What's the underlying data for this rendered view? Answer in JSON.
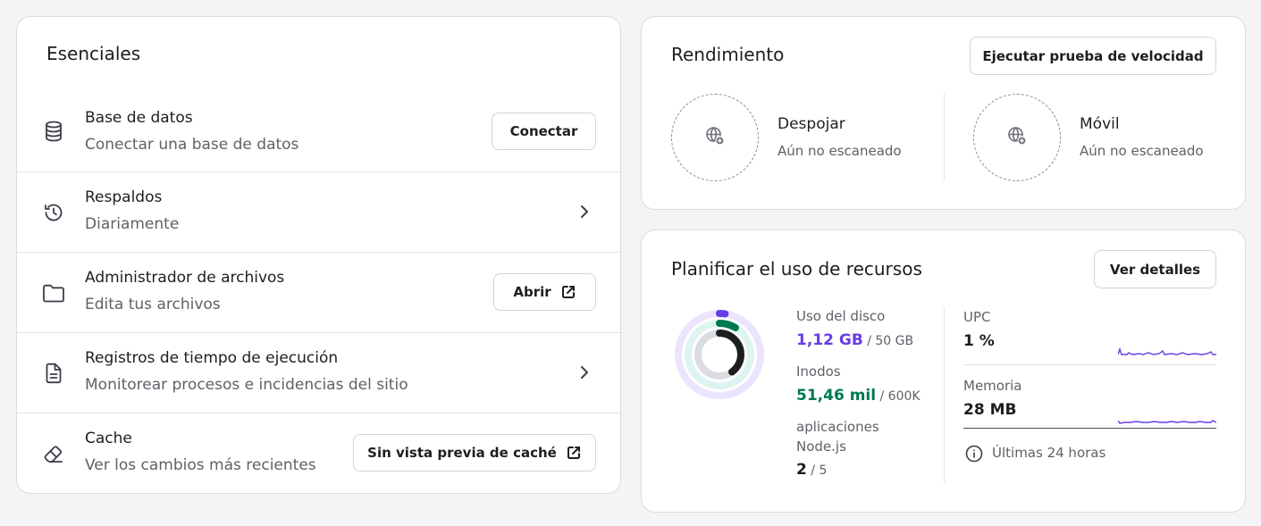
{
  "essentials": {
    "title": "Esenciales",
    "rows": [
      {
        "title": "Base de datos",
        "subtitle": "Conectar una base de datos",
        "icon": "database-icon",
        "action_label": "Conectar"
      },
      {
        "title": "Respaldos",
        "subtitle": "Diariamente",
        "icon": "history-icon"
      },
      {
        "title": "Administrador de archivos",
        "subtitle": "Edita tus archivos",
        "icon": "folder-icon",
        "action_label": "Abrir"
      },
      {
        "title": "Registros de tiempo de ejecución",
        "subtitle": "Monitorear procesos e incidencias del sitio",
        "icon": "document-icon"
      },
      {
        "title": "Cache",
        "subtitle": "Ver los cambios más recientes",
        "icon": "eraser-icon",
        "action_label": "Sin vista previa de caché"
      }
    ]
  },
  "performance": {
    "title": "Rendimiento",
    "button_label": "Ejecutar prueba de velocidad",
    "desktop": {
      "label": "Despojar",
      "status": "Aún no escaneado",
      "icon": "globe-plus-icon"
    },
    "mobile": {
      "label": "Móvil",
      "status": "Aún no escaneado",
      "icon": "globe-plus-icon"
    }
  },
  "resources": {
    "title": "Planificar el uso de recursos",
    "button_label": "Ver detalles",
    "disk": {
      "label": "Uso del disco",
      "used": "1,12 GB",
      "total": "/ 50 GB",
      "fraction": 0.0224,
      "color": "#673de6"
    },
    "inodes": {
      "label": "Inodos",
      "used": "51,46 mil",
      "total": "/ 600K",
      "fraction": 0.0858,
      "color": "#00794e"
    },
    "node_apps": {
      "label_line1": "aplicaciones",
      "label_line2": "Node.js",
      "used": "2",
      "total": "/ 5",
      "fraction": 0.4,
      "color": "#1d1e20"
    },
    "cpu": {
      "label": "UPC",
      "value": "1 %"
    },
    "memory": {
      "label": "Memoria",
      "value": "28 MB"
    },
    "period_label": "Últimas 24 horas"
  },
  "colors": {
    "accent_purple": "#673de6",
    "accent_green": "#00794e",
    "text_primary": "#1d1e20",
    "text_secondary": "#5f6168"
  }
}
